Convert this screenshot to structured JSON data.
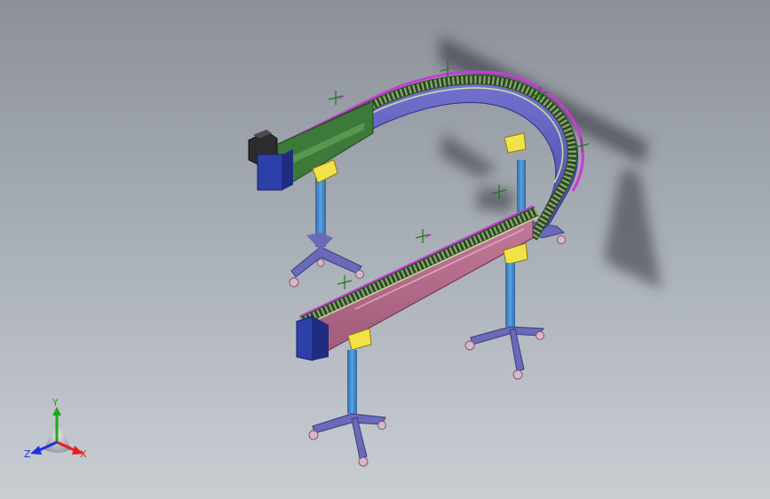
{
  "view": {
    "background_top": "#8b9099",
    "background_bottom": "#c9ced3"
  },
  "model": {
    "frame_color_rear": "#5a5ab8",
    "frame_color_front": "#b86a8a",
    "frame_color_left": "#3d7a3a",
    "chain_color": "#2f4a28",
    "rail_color": "#cfe0a8",
    "leg_color": "#3a86c8",
    "base_color": "#6a6ab8",
    "bracket_color": "#f2e24a",
    "motor_color": "#2c2c2e",
    "end_cap_color": "#2d3fa8"
  },
  "triad": {
    "x_label": "X",
    "y_label": "Y",
    "z_label": "Z",
    "x_color": "#e02020",
    "y_color": "#1fa81f",
    "z_color": "#2030e0"
  }
}
